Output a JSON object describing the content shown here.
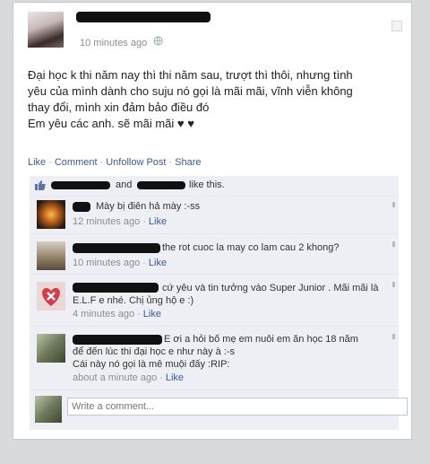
{
  "post": {
    "timestamp": "10 minutes ago",
    "privacy_icon": "globe-icon",
    "text_lines": [
      "Đại học k thi năm nay thì thi năm sau, trượt thì thôi, nhưng tình",
      "yêu của mình dành cho suju nó gọi là mãi mãi, vĩnh viễn không",
      "thay đổi, mình xin đảm bảo điều đó",
      "Em yêu các anh. sẽ mãi mãi ♥ ♥"
    ],
    "actions": {
      "like": "Like",
      "comment": "Comment",
      "unfollow": "Unfollow Post",
      "share": "Share"
    }
  },
  "likes": {
    "and": "and",
    "suffix": "like this."
  },
  "comments": [
    {
      "text": "Mày bị điên hả mày :-ss",
      "time": "12 minutes ago",
      "like": "Like"
    },
    {
      "text": "the rot cuoc la may co lam cau 2 khong?",
      "time": "10 minutes ago",
      "like": "Like"
    },
    {
      "line1": "cứ yêu và tin tưởng vào Super Junior . Mãi mãi là",
      "line2": "E.L.F e nhé. Chị ủng hộ e :)",
      "time": "4 minutes ago",
      "like": "Like"
    },
    {
      "line1": "E ơi a hỏi bố mẹ em nuôi em ăn học 18 năm",
      "line2": "để đến lúc thi đại học e như này à :-s",
      "line3": "Cái này nó gọi là mê muội đấy :RIP:",
      "time": "about a minute ago",
      "like": "Like"
    }
  ],
  "write_comment": {
    "placeholder": "Write a comment..."
  },
  "colors": {
    "link": "#3b5998",
    "feedback_bg": "#edeff4",
    "meta_gray": "#8a8d92"
  }
}
